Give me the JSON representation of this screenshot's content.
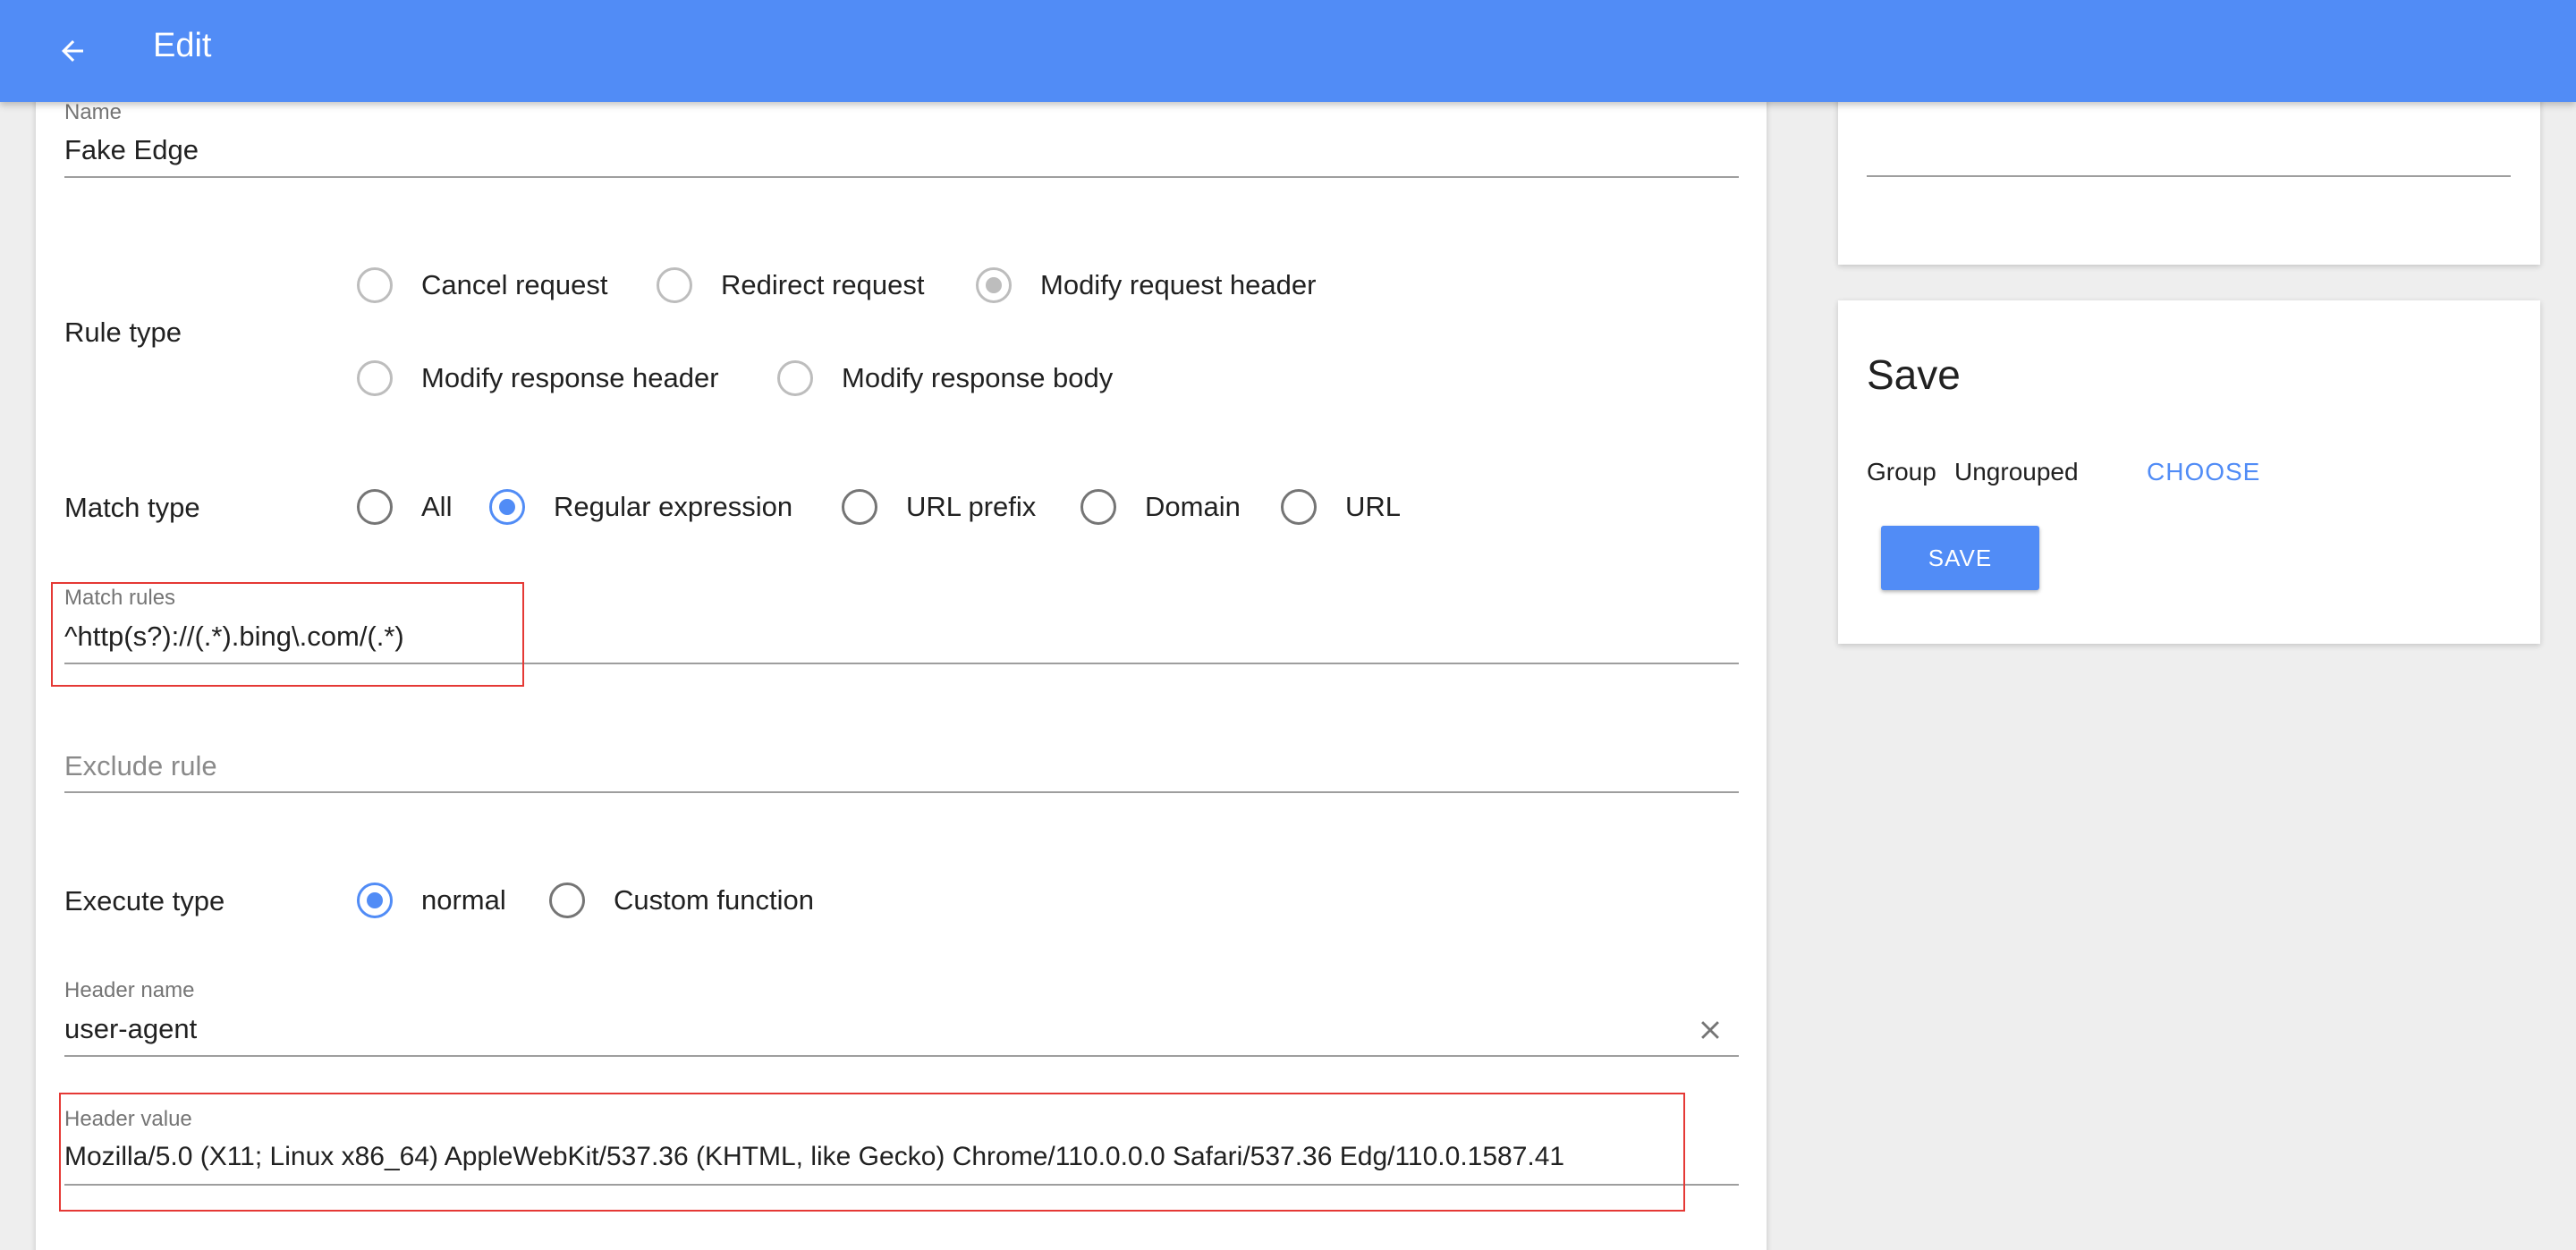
{
  "appbar": {
    "title": "Edit"
  },
  "form": {
    "name": {
      "label": "Name",
      "value": "Fake Edge"
    },
    "rule_type": {
      "label": "Rule type",
      "options": [
        "Cancel request",
        "Redirect request",
        "Modify request header",
        "Modify response header",
        "Modify response body"
      ],
      "selected": "Modify request header"
    },
    "match_type": {
      "label": "Match type",
      "options": [
        "All",
        "Regular expression",
        "URL prefix",
        "Domain",
        "URL"
      ],
      "selected": "Regular expression"
    },
    "match_rules": {
      "label": "Match rules",
      "value": "^http(s?)://(.*).bing\\.com/(.*)"
    },
    "exclude_rule": {
      "placeholder": "Exclude rule"
    },
    "execute_type": {
      "label": "Execute type",
      "options": [
        "normal",
        "Custom function"
      ],
      "selected": "normal"
    },
    "header_name": {
      "label": "Header name",
      "value": "user-agent"
    },
    "header_value": {
      "label": "Header value",
      "value": "Mozilla/5.0 (X11; Linux x86_64) AppleWebKit/537.36 (KHTML, like Gecko) Chrome/110.0.0.0 Safari/537.36 Edg/110.0.1587.41"
    }
  },
  "save_panel": {
    "title": "Save",
    "group_label": "Group",
    "group_value": "Ungrouped",
    "choose_label": "CHOOSE",
    "save_label": "SAVE"
  },
  "colors": {
    "primary": "#518cf6",
    "highlight": "#e53935"
  },
  "icons": {
    "back": "arrow-left-icon",
    "clear": "close-icon"
  }
}
